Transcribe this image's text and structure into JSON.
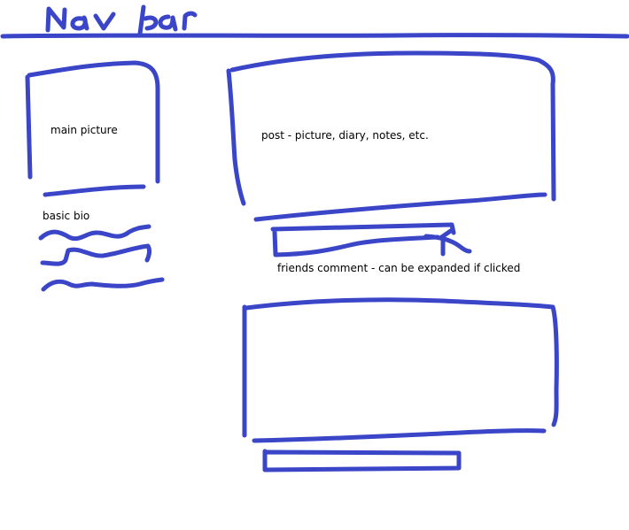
{
  "colors": {
    "ink": "#3a45c8",
    "text": "#000000",
    "background": "#ffffff"
  },
  "header": {
    "title": "Nav bar"
  },
  "profile": {
    "main_picture_label": "main picture",
    "bio_label": "basic bio"
  },
  "feed": {
    "post_label": "post - picture, diary, notes, etc.",
    "comment_label": "friends comment - can be expanded if clicked"
  }
}
